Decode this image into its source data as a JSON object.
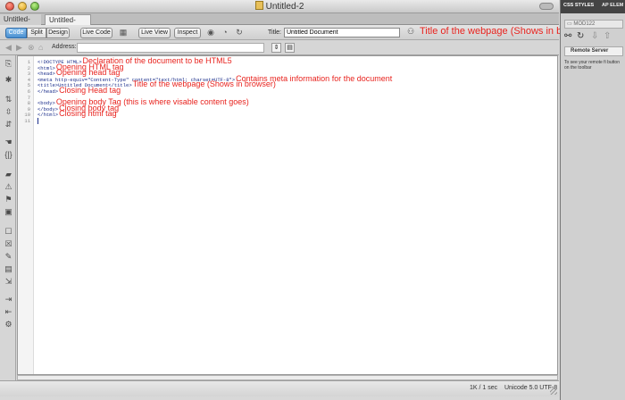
{
  "window": {
    "title": "Untitled-2"
  },
  "tabs": [
    {
      "label": "Untitled-1",
      "close": "×"
    },
    {
      "label": "Untitled-2",
      "close": "×"
    }
  ],
  "toolbar": {
    "code": "Code",
    "split": "Split",
    "design": "Design",
    "live_code": "Live Code",
    "live_view": "Live View",
    "inspect": "Inspect",
    "title_label": "Title:",
    "title_value": "Untitled Document",
    "title_annotation": "Title of the webpage (Shows in browser)"
  },
  "address": {
    "label": "Address:",
    "value": ""
  },
  "editor": {
    "line_numbers": [
      "1",
      "2",
      "3",
      "4",
      "5",
      "6",
      "7",
      "8",
      "9",
      "10",
      "11"
    ],
    "lines": [
      {
        "code": "<!DOCTYPE HTML>",
        "note": "Declaration of the document to be HTML5"
      },
      {
        "code": "<html>",
        "note": "Opening HTML tag"
      },
      {
        "code": "<head>",
        "note": "Opening head tag"
      },
      {
        "code": "<meta http-equiv=\"Content-Type\" content=\"text/html; charset=UTF-8\">",
        "note": "Contains meta information for the document"
      },
      {
        "code": "<title>Untitled Document</title>",
        "note": "Title of the webpage (Shows in browser)"
      },
      {
        "code": "</head>",
        "note": "Closing Head tag"
      },
      {
        "code": "",
        "note": ""
      },
      {
        "code": "<body>",
        "note": "Opening body Tag (this is where visable content goes)"
      },
      {
        "code": "</body>",
        "note": "Closing body tag"
      },
      {
        "code": "</html>",
        "note": "Closing html tag"
      },
      {
        "code": "",
        "note": ""
      }
    ]
  },
  "status": {
    "size": "1K / 1 sec",
    "encoding": "Unicode 5.0 UTF-8"
  },
  "right_panel": {
    "tab1": "CSS STYLES",
    "tab2": "AP ELEM",
    "site": "MOD122",
    "remote": "Remote Server",
    "message": "To see your remote fi button on the toolbar"
  },
  "colors": {
    "annotation": "#e8231e",
    "code": "#1a2d8a",
    "active_button": "#4a8fd0"
  }
}
